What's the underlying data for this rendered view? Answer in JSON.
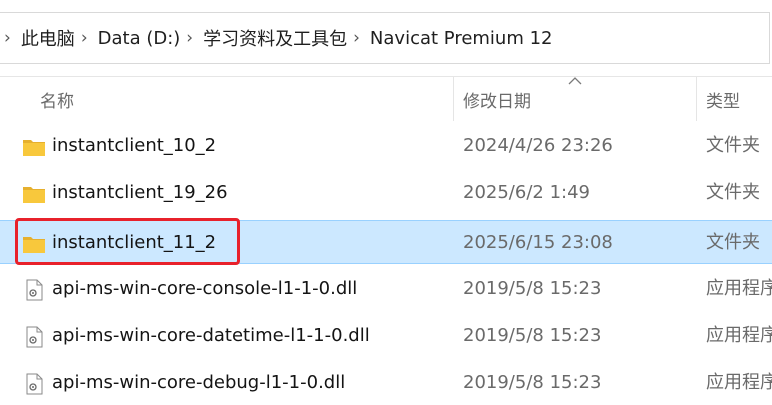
{
  "breadcrumb": [
    {
      "label": "此电脑"
    },
    {
      "label": "Data (D:)"
    },
    {
      "label": "学习资料及工具包"
    },
    {
      "label": "Navicat Premium 12"
    }
  ],
  "columns": {
    "name": "名称",
    "date": "修改日期",
    "type": "类型"
  },
  "rows": [
    {
      "icon": "folder-icon",
      "name": "instantclient_10_2",
      "date": "2024/4/26 23:26",
      "type": "文件夹",
      "selected": false
    },
    {
      "icon": "folder-icon",
      "name": "instantclient_19_26",
      "date": "2025/6/2 1:49",
      "type": "文件夹",
      "selected": false
    },
    {
      "icon": "folder-icon",
      "name": "instantclient_11_2",
      "date": "2025/6/15 23:08",
      "type": "文件夹",
      "selected": true
    },
    {
      "icon": "dll-file-icon",
      "name": "api-ms-win-core-console-l1-1-0.dll",
      "date": "2019/5/8 15:23",
      "type": "应用程序扩展",
      "selected": false
    },
    {
      "icon": "dll-file-icon",
      "name": "api-ms-win-core-datetime-l1-1-0.dll",
      "date": "2019/5/8 15:23",
      "type": "应用程序扩展",
      "selected": false
    },
    {
      "icon": "dll-file-icon",
      "name": "api-ms-win-core-debug-l1-1-0.dll",
      "date": "2019/5/8 15:23",
      "type": "应用程序扩展",
      "selected": false
    }
  ],
  "colors": {
    "selection": "#cce8ff",
    "selection_border": "#99d1ff",
    "highlight": "#e8212b",
    "folder": "#f8c83c"
  }
}
